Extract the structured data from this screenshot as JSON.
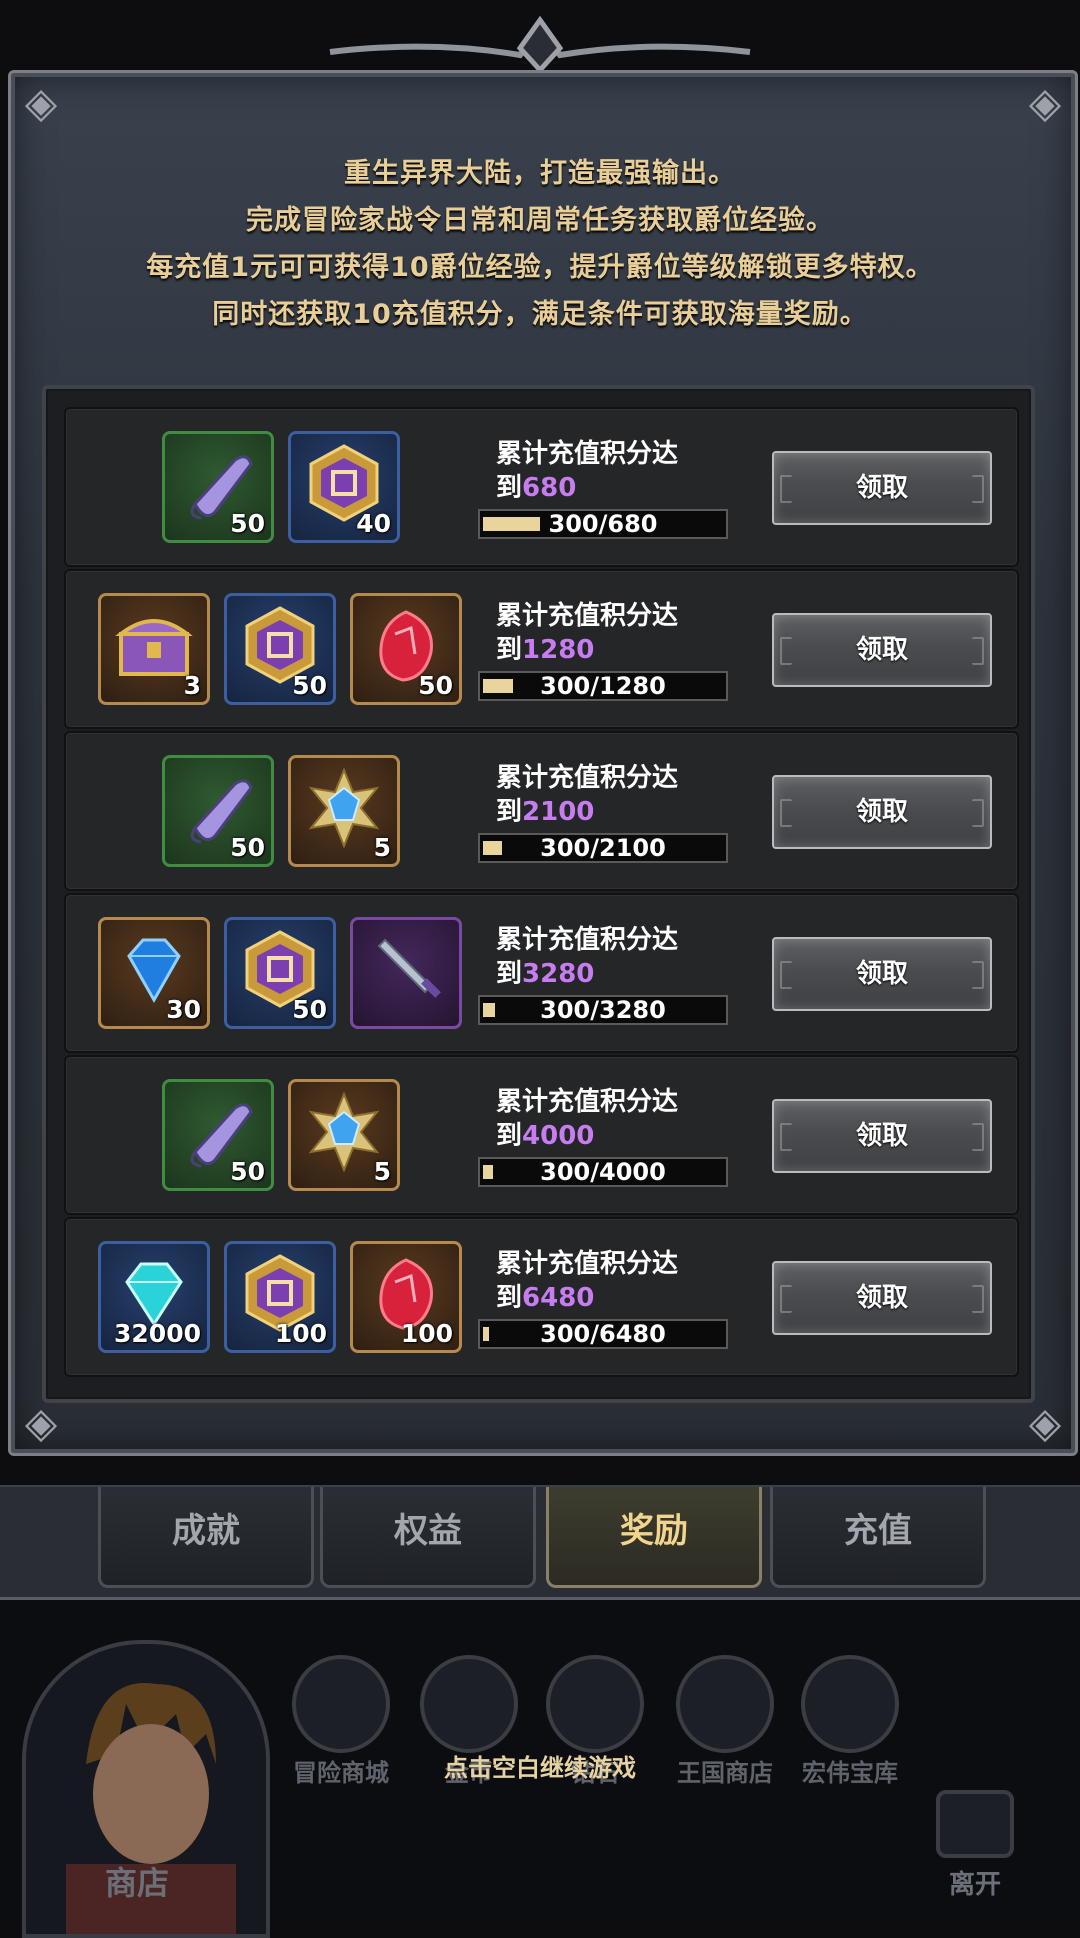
{
  "intro": {
    "lines": [
      "重生异界大陆，打造最强输出。",
      "完成冒险家战令日常和周常任务获取爵位经验。",
      "每充值1元可可获得10爵位经验，提升爵位等级解锁更多特权。",
      "同时还获取10充值积分，满足条件可获取海量奖励。"
    ]
  },
  "rewards": [
    {
      "req_prefix": "累计充值积分达",
      "req_to": "到",
      "target": "680",
      "progress": "300/680",
      "fraction": 0.441,
      "items": [
        {
          "icon": "scroll-icon",
          "frame": "green",
          "qty": "50"
        },
        {
          "icon": "crest-coin-icon",
          "frame": "blue",
          "qty": "40"
        }
      ],
      "claim_label": "领取"
    },
    {
      "req_prefix": "累计充值积分达",
      "req_to": "到",
      "target": "1280",
      "progress": "300/1280",
      "fraction": 0.234,
      "items": [
        {
          "icon": "treasure-chest-icon",
          "frame": "gold",
          "qty": "3"
        },
        {
          "icon": "crest-coin-icon",
          "frame": "blue",
          "qty": "50"
        },
        {
          "icon": "red-crystal-icon",
          "frame": "gold",
          "qty": "50"
        }
      ],
      "claim_label": "领取"
    },
    {
      "req_prefix": "累计充值积分达",
      "req_to": "到",
      "target": "2100",
      "progress": "300/2100",
      "fraction": 0.143,
      "items": [
        {
          "icon": "scroll-icon",
          "frame": "green",
          "qty": "50"
        },
        {
          "icon": "blue-star-gem-icon",
          "frame": "gold",
          "qty": "5"
        }
      ],
      "claim_label": "领取"
    },
    {
      "req_prefix": "累计充值积分达",
      "req_to": "到",
      "target": "3280",
      "progress": "300/3280",
      "fraction": 0.091,
      "items": [
        {
          "icon": "blue-diamond-icon",
          "frame": "gold",
          "qty": "30"
        },
        {
          "icon": "crest-coin-icon",
          "frame": "blue",
          "qty": "50"
        },
        {
          "icon": "sword-icon",
          "frame": "purple",
          "qty": ""
        }
      ],
      "claim_label": "领取"
    },
    {
      "req_prefix": "累计充值积分达",
      "req_to": "到",
      "target": "4000",
      "progress": "300/4000",
      "fraction": 0.075,
      "items": [
        {
          "icon": "scroll-icon",
          "frame": "green",
          "qty": "50"
        },
        {
          "icon": "blue-star-gem-icon",
          "frame": "gold",
          "qty": "5"
        }
      ],
      "claim_label": "领取"
    },
    {
      "req_prefix": "累计充值积分达",
      "req_to": "到",
      "target": "6480",
      "progress": "300/6480",
      "fraction": 0.046,
      "items": [
        {
          "icon": "cyan-diamond-icon",
          "frame": "blue",
          "qty": "32000"
        },
        {
          "icon": "crest-coin-icon",
          "frame": "blue",
          "qty": "100"
        },
        {
          "icon": "red-crystal-icon",
          "frame": "gold",
          "qty": "100"
        }
      ],
      "claim_label": "领取"
    }
  ],
  "tabs": [
    {
      "label": "成就",
      "active": false
    },
    {
      "label": "权益",
      "active": false
    },
    {
      "label": "奖励",
      "active": true
    },
    {
      "label": "充值",
      "active": false
    }
  ],
  "background": {
    "shop_label": "商店",
    "nav": [
      "冒险商城",
      "金币",
      "钻石",
      "王国商店",
      "宏伟宝库"
    ],
    "leave_label": "离开",
    "hint": "点击空白继续游戏"
  },
  "colors": {
    "accent_gold": "#e9cf97",
    "target_purple": "#c77df0",
    "progress_fill": "#e8d49c"
  }
}
